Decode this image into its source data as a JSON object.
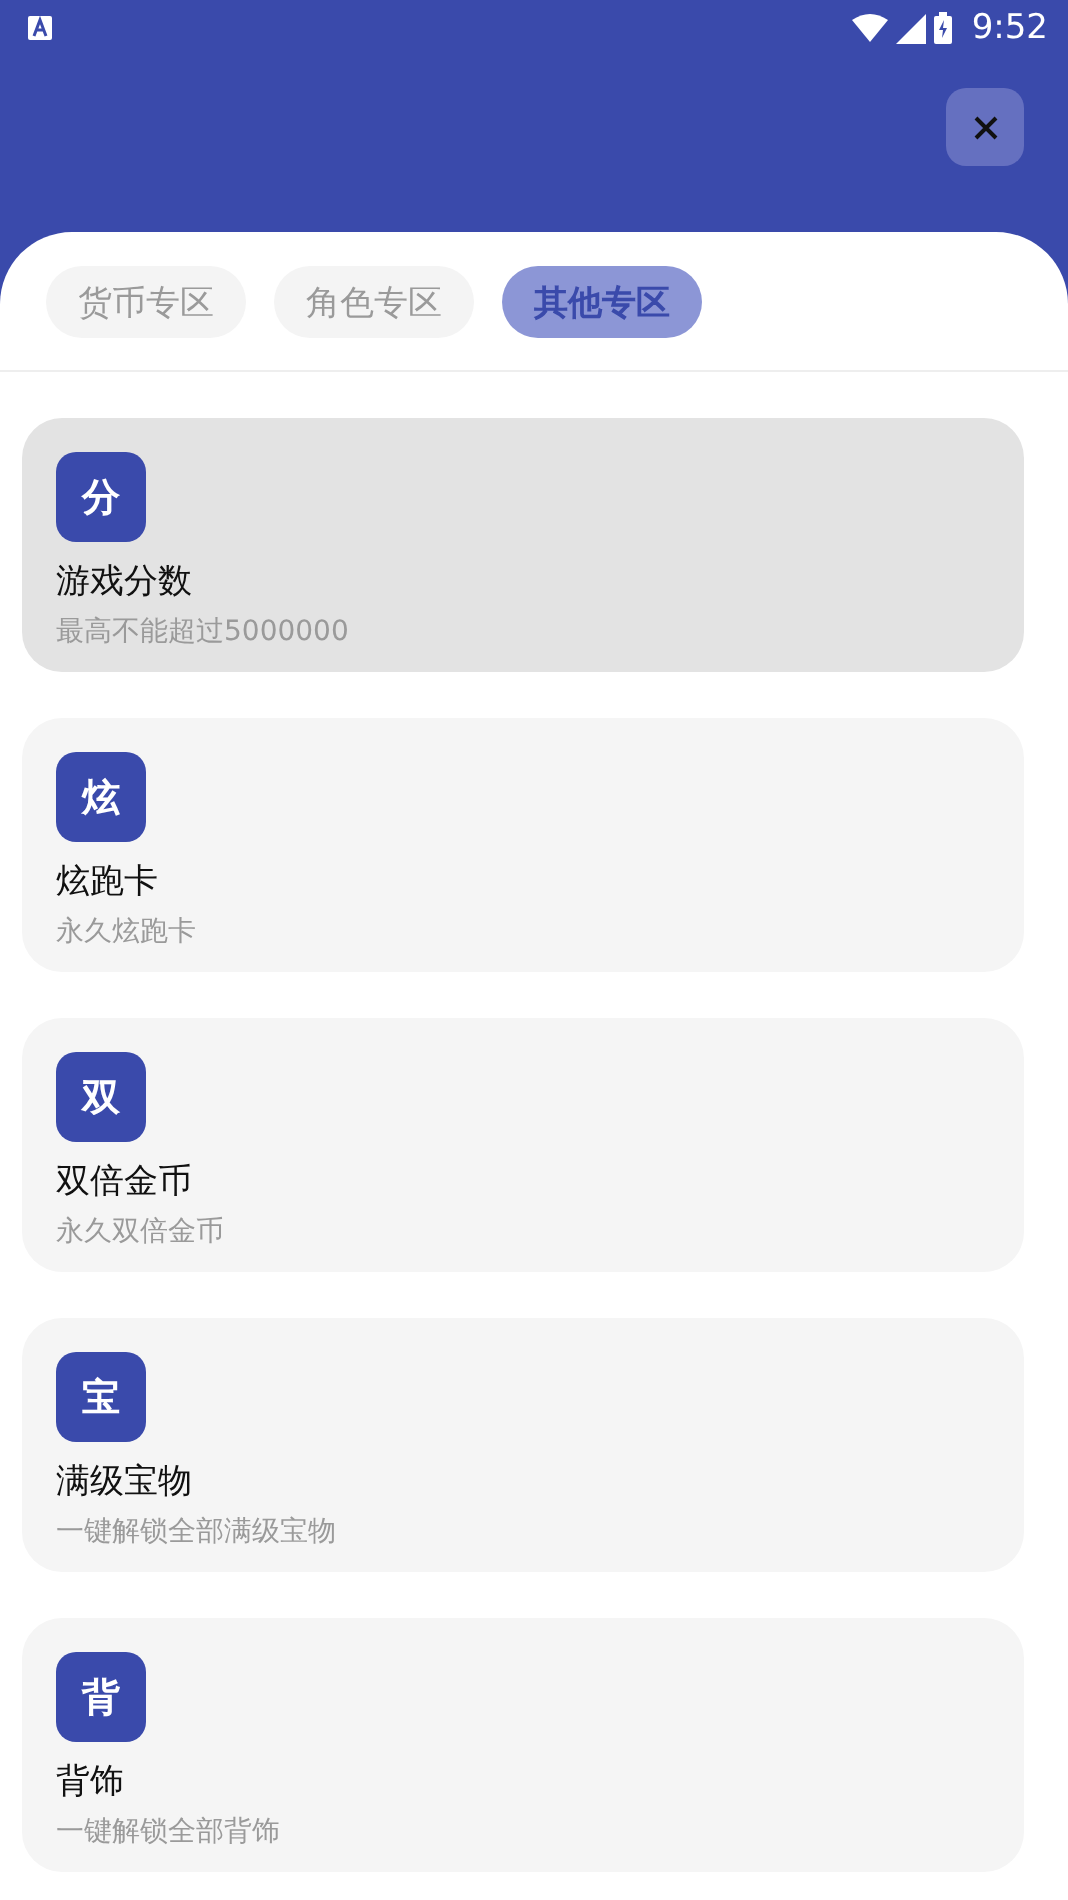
{
  "status_bar": {
    "time": "9:52"
  },
  "tabs": [
    {
      "label": "货币专区",
      "selected": false
    },
    {
      "label": "角色专区",
      "selected": false
    },
    {
      "label": "其他专区",
      "selected": true
    }
  ],
  "items": [
    {
      "badge": "分",
      "title": "游戏分数",
      "subtitle": "最高不能超过5000000",
      "selected": true
    },
    {
      "badge": "炫",
      "title": "炫跑卡",
      "subtitle": "永久炫跑卡",
      "selected": false
    },
    {
      "badge": "双",
      "title": "双倍金币",
      "subtitle": "永久双倍金币",
      "selected": false
    },
    {
      "badge": "宝",
      "title": "满级宝物",
      "subtitle": "一键解锁全部满级宝物",
      "selected": false
    },
    {
      "badge": "背",
      "title": "背饰",
      "subtitle": "一键解锁全部背饰",
      "selected": false
    }
  ]
}
